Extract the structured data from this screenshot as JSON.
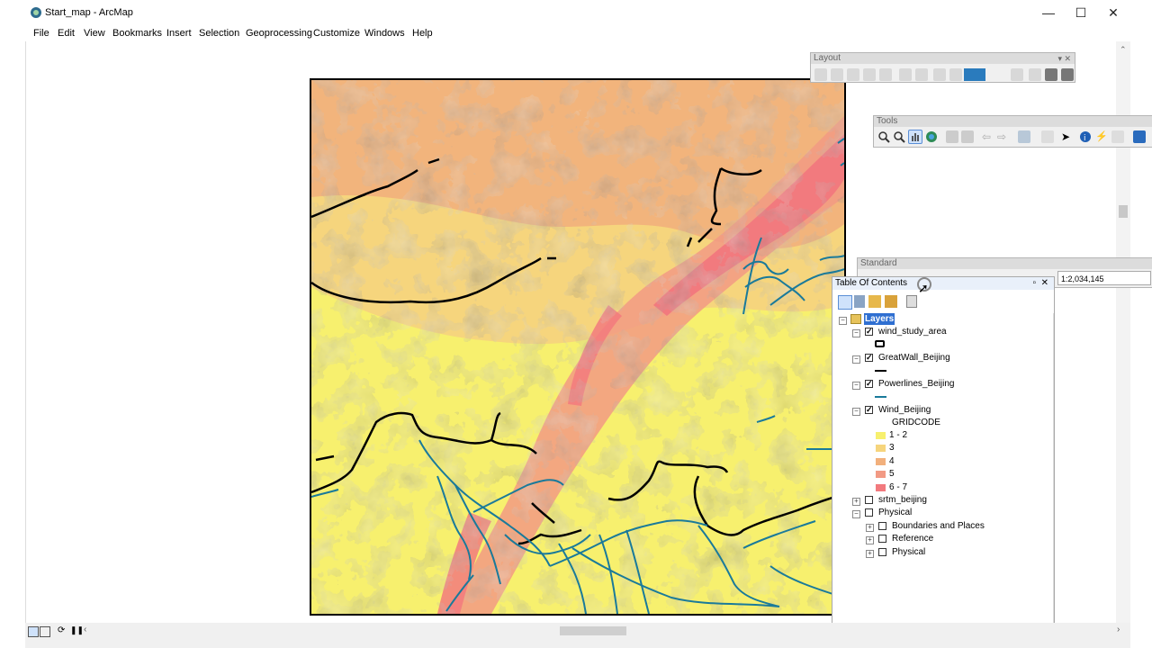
{
  "window": {
    "title": "Start_map - ArcMap",
    "minimize": "—",
    "maximize": "☐",
    "close": "✕"
  },
  "menu": [
    "File",
    "Edit",
    "View",
    "Bookmarks",
    "Insert",
    "Selection",
    "Geoprocessing",
    "Customize",
    "Windows",
    "Help"
  ],
  "toolbars": {
    "layout_title": "Layout",
    "tools_title": "Tools",
    "standard_title": "Standard",
    "scale_value": "1:2,034,145"
  },
  "toc": {
    "title": "Table Of Contents",
    "root": "Layers",
    "layers": [
      {
        "name": "wind_study_area",
        "checked": true
      },
      {
        "name": "GreatWall_Beijing",
        "checked": true
      },
      {
        "name": "Powerlines_Beijing",
        "checked": true
      },
      {
        "name": "Wind_Beijing",
        "checked": true
      },
      {
        "name": "srtm_beijing",
        "checked": false
      },
      {
        "name": "Physical",
        "checked": false
      }
    ],
    "wind_field": "GRIDCODE",
    "wind_classes": [
      {
        "label": "1 - 2",
        "color": "#f7f06e"
      },
      {
        "label": "3",
        "color": "#f6d57d"
      },
      {
        "label": "4",
        "color": "#f2b07c"
      },
      {
        "label": "5",
        "color": "#f29a84"
      },
      {
        "label": "6 - 7",
        "color": "#f27a7e"
      }
    ],
    "physical_children": [
      "Boundaries and Places",
      "Reference",
      "Physical"
    ]
  },
  "colors": {
    "great_wall": "#000000",
    "powerlines": "#1a7a9a",
    "map_frame": "#000000"
  }
}
